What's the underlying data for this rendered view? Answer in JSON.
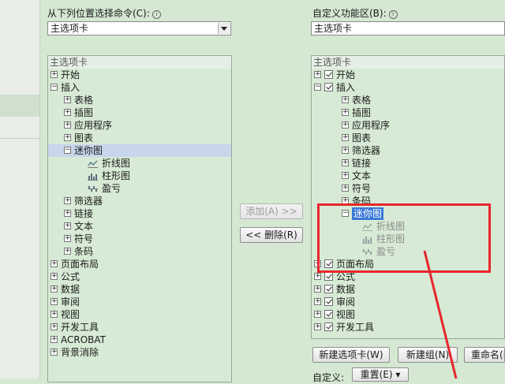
{
  "left_header": {
    "label": "从下列位置选择命令(C):"
  },
  "left_combo": {
    "value": "主选项卡"
  },
  "left_tree": {
    "head": "主选项卡",
    "items": [
      {
        "text": "开始",
        "level": 0,
        "exp": "+"
      },
      {
        "text": "插入",
        "level": 0,
        "exp": "-"
      },
      {
        "text": "表格",
        "level": 1,
        "exp": "+"
      },
      {
        "text": "插图",
        "level": 1,
        "exp": "+"
      },
      {
        "text": "应用程序",
        "level": 1,
        "exp": "+"
      },
      {
        "text": "图表",
        "level": 1,
        "exp": "+"
      },
      {
        "text": "迷你图",
        "level": 1,
        "exp": "-",
        "hl": true
      },
      {
        "text": "折线图",
        "level": 2,
        "icon": "line-chart-icon"
      },
      {
        "text": "柱形图",
        "level": 2,
        "icon": "column-chart-icon"
      },
      {
        "text": "盈亏",
        "level": 2,
        "icon": "win-loss-icon"
      },
      {
        "text": "筛选器",
        "level": 1,
        "exp": "+"
      },
      {
        "text": "链接",
        "level": 1,
        "exp": "+"
      },
      {
        "text": "文本",
        "level": 1,
        "exp": "+"
      },
      {
        "text": "符号",
        "level": 1,
        "exp": "+"
      },
      {
        "text": "条码",
        "level": 1,
        "exp": "+"
      },
      {
        "text": "页面布局",
        "level": 0,
        "exp": "+"
      },
      {
        "text": "公式",
        "level": 0,
        "exp": "+"
      },
      {
        "text": "数据",
        "level": 0,
        "exp": "+"
      },
      {
        "text": "审阅",
        "level": 0,
        "exp": "+"
      },
      {
        "text": "视图",
        "level": 0,
        "exp": "+"
      },
      {
        "text": "开发工具",
        "level": 0,
        "exp": "+"
      },
      {
        "text": "ACROBAT",
        "level": 0,
        "exp": "+"
      },
      {
        "text": "背景消除",
        "level": 0,
        "exp": "+"
      }
    ]
  },
  "middle": {
    "add_label": "添加(A) >>",
    "remove_label": "<< 删除(R)"
  },
  "right_header": {
    "label": "自定义功能区(B):"
  },
  "right_combo": {
    "value": "主选项卡"
  },
  "right_tree": {
    "head": "主选项卡",
    "items": [
      {
        "text": "开始",
        "level": 0,
        "exp": "+",
        "cb": true
      },
      {
        "text": "插入",
        "level": 0,
        "exp": "-",
        "cb": true
      },
      {
        "text": "表格",
        "level": 1,
        "exp": "+"
      },
      {
        "text": "插图",
        "level": 1,
        "exp": "+"
      },
      {
        "text": "应用程序",
        "level": 1,
        "exp": "+"
      },
      {
        "text": "图表",
        "level": 1,
        "exp": "+"
      },
      {
        "text": "筛选器",
        "level": 1,
        "exp": "+"
      },
      {
        "text": "链接",
        "level": 1,
        "exp": "+"
      },
      {
        "text": "文本",
        "level": 1,
        "exp": "+"
      },
      {
        "text": "符号",
        "level": 1,
        "exp": "+"
      },
      {
        "text": "条码",
        "level": 1,
        "exp": "+"
      },
      {
        "text": "迷你图",
        "level": 1,
        "exp": "-",
        "selected": true
      },
      {
        "text": "折线图",
        "level": 2,
        "icon": "line-chart-icon",
        "greyed": true
      },
      {
        "text": "柱形图",
        "level": 2,
        "icon": "column-chart-icon",
        "greyed": true
      },
      {
        "text": "盈亏",
        "level": 2,
        "icon": "win-loss-icon",
        "greyed": true
      },
      {
        "text": "页面布局",
        "level": 0,
        "exp": "+",
        "cb": true
      },
      {
        "text": "公式",
        "level": 0,
        "exp": "+",
        "cb": true
      },
      {
        "text": "数据",
        "level": 0,
        "exp": "+",
        "cb": true
      },
      {
        "text": "审阅",
        "level": 0,
        "exp": "+",
        "cb": true
      },
      {
        "text": "视图",
        "level": 0,
        "exp": "+",
        "cb": true
      },
      {
        "text": "开发工具",
        "level": 0,
        "exp": "+",
        "cb": true
      }
    ]
  },
  "bottom_buttons": {
    "new_tab": "新建选项卡(W)",
    "new_group": "新建组(N)",
    "rename": "重命名(M)..."
  },
  "customize": {
    "label": "自定义:",
    "reset": "重置(E) ▾"
  },
  "colors": {
    "annotation": "#e8262c",
    "selection": "#3a78d8",
    "panel": "#d4e8d2"
  }
}
